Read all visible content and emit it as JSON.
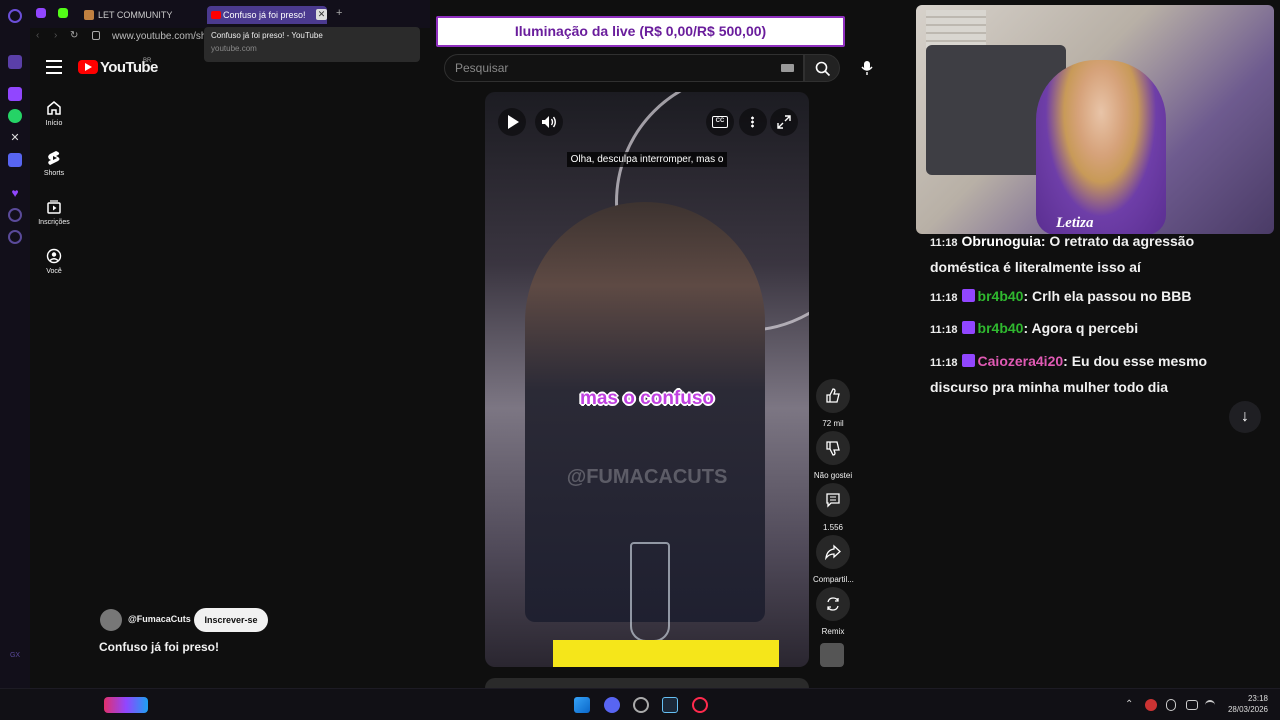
{
  "browser": {
    "tabs": [
      {
        "label": "LET COMMUNITY",
        "active": false
      },
      {
        "label": "Confuso já foi preso!",
        "active": true
      }
    ],
    "new_tab": "+",
    "url": "www.youtube.com/sho",
    "tooltip": {
      "title": "Confuso já foi preso! - YouTube",
      "domain": "youtube.com"
    }
  },
  "youtube": {
    "logo_text": "YouTube",
    "region": "BR",
    "search_placeholder": "Pesquisar",
    "nav": [
      {
        "label": "Início",
        "icon": "home-icon"
      },
      {
        "label": "Shorts",
        "icon": "shorts-icon"
      },
      {
        "label": "Inscrições",
        "icon": "subscriptions-icon"
      },
      {
        "label": "Você",
        "icon": "you-icon"
      }
    ],
    "short": {
      "top_caption": "Olha, desculpa interromper, mas o",
      "subtitle": "mas o confuso",
      "watermark": "@FUMACACUTS",
      "channel": "@FumacaCuts",
      "subscribe": "Inscrever-se",
      "title": "Confuso já foi preso!"
    },
    "actions": [
      {
        "label": "72 mil",
        "icon": "like-icon"
      },
      {
        "label": "Não gostei",
        "icon": "dislike-icon"
      },
      {
        "label": "1.556",
        "icon": "comment-icon"
      },
      {
        "label": "Compartil...",
        "icon": "share-icon"
      },
      {
        "label": "Remix",
        "icon": "remix-icon"
      }
    ]
  },
  "overlay": {
    "banner": "Iluminação da live (R$ 0,00/R$ 500,00)",
    "webcam_name": "Letiza"
  },
  "chat": [
    {
      "time": "11:18",
      "user": "Obrunoguia",
      "user_color": "#ffffff",
      "message": "O retrato da agressão doméstica é literalmente isso aí"
    },
    {
      "time": "11:18",
      "user": "br4b40",
      "user_color": "#2fb82f",
      "message": "Crlh ela passou no BBB"
    },
    {
      "time": "11:18",
      "user": "br4b40",
      "user_color": "#2fb82f",
      "message": "Agora q percebi"
    },
    {
      "time": "11:18",
      "user": "Caiozera4i20",
      "user_color": "#e05ab4",
      "message": "Eu dou esse mesmo discurso pra minha mulher todo dia"
    }
  ],
  "taskbar": {
    "time": "23:18",
    "date": "28/03/2026"
  },
  "colors": {
    "accent": "#9146ff",
    "banner_text": "#6a1d9c",
    "subtitle": "#c040e0"
  }
}
